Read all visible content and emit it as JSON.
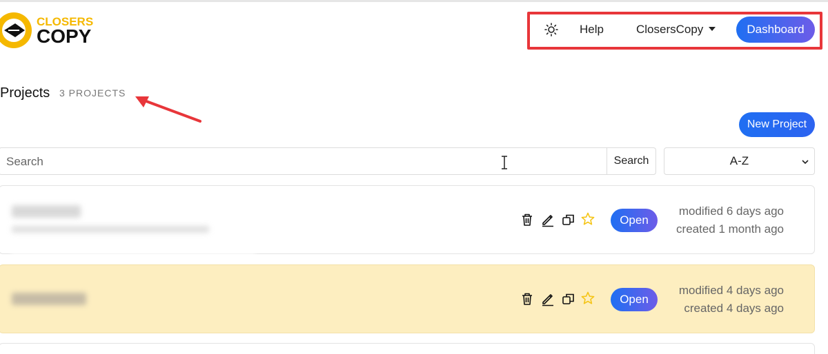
{
  "brand": {
    "logo_top": "CLOSERS",
    "logo_bottom": "COPY",
    "colors": {
      "yellow": "#f5b800",
      "dark": "#111111"
    }
  },
  "nav": {
    "theme_icon": "sun-icon",
    "help_label": "Help",
    "account_label": "ClosersCopy",
    "dashboard_label": "Dashboard"
  },
  "header": {
    "title": "Projects",
    "count_label": "3 PROJECTS"
  },
  "toolbar": {
    "new_project_label": "New Project",
    "search_placeholder": "Search",
    "search_button_label": "Search",
    "sort_value": "A-Z"
  },
  "projects": [
    {
      "open_label": "Open",
      "modified": "modified 6 days ago",
      "created": "created 1 month ago",
      "icons": [
        "trash-icon",
        "edit-icon",
        "duplicate-icon",
        "star-icon"
      ]
    },
    {
      "open_label": "Open",
      "modified": "modified 4 days ago",
      "created": "created 4 days ago",
      "icons": [
        "trash-icon",
        "edit-icon",
        "duplicate-icon",
        "star-icon"
      ],
      "highlighted": true
    }
  ],
  "colors": {
    "accent_start": "#1f6ff2",
    "accent_end": "#6d5ce8",
    "annotation_red": "#e8363a",
    "highlight_row": "#fdeec0",
    "star": "#f5c518"
  }
}
